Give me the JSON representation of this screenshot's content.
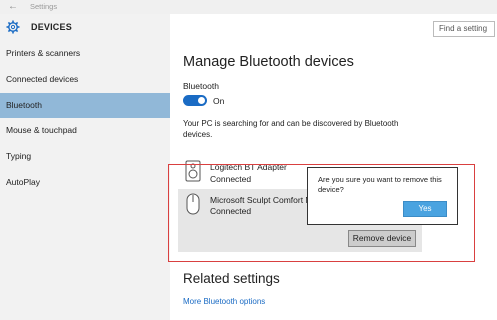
{
  "window": {
    "back_glyph": "←",
    "title": "Settings"
  },
  "header": {
    "section": "DEVICES",
    "search_placeholder": "Find a setting"
  },
  "sidebar": {
    "items": [
      {
        "label": "Printers & scanners"
      },
      {
        "label": "Connected devices"
      },
      {
        "label": "Bluetooth",
        "active": true
      },
      {
        "label": "Mouse & touchpad"
      },
      {
        "label": "Typing"
      },
      {
        "label": "AutoPlay"
      }
    ]
  },
  "main": {
    "title": "Manage Bluetooth devices",
    "bluetooth_label": "Bluetooth",
    "toggle_state": "On",
    "info_text": "Your PC is searching for and can be discovered by Bluetooth devices.",
    "devices": [
      {
        "name": "Logitech BT Adapter",
        "status": "Connected",
        "icon": "speaker-icon"
      },
      {
        "name": "Microsoft Sculpt Comfort M",
        "status": "Connected",
        "icon": "mouse-icon"
      }
    ],
    "remove_button": "Remove device",
    "related_title": "Related settings",
    "related_link": "More Bluetooth options"
  },
  "dialog": {
    "message": "Are you sure you want to remove this device?",
    "yes_button": "Yes"
  },
  "colors": {
    "accent": "#1a6bc4",
    "active_nav": "#91b8d8",
    "highlight_border": "#d94040",
    "yes_button": "#4aa3e0"
  }
}
